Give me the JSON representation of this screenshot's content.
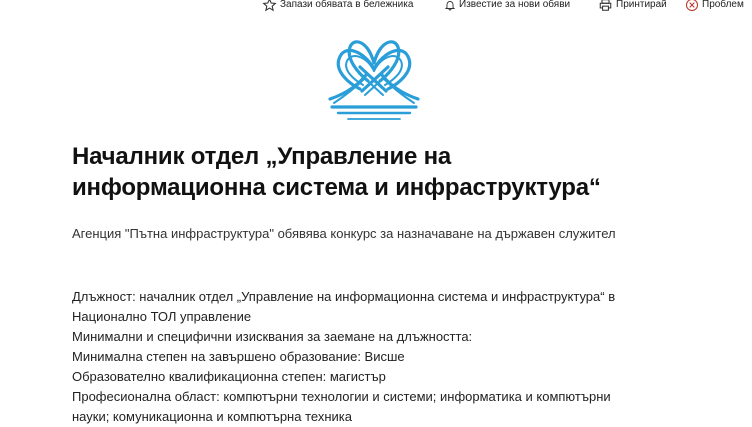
{
  "toolbar": {
    "save": "Запази обявата в бележника",
    "notify": "Известие за нови обяви",
    "print": "Принтирай",
    "report": "Проблем"
  },
  "icons": {
    "save": "star-icon",
    "notify": "bell-icon",
    "print": "printer-icon",
    "report": "close-circle-icon"
  },
  "colors": {
    "logo": "#2a9ed8",
    "report_icon": "#c0392b"
  },
  "article": {
    "title_line1": "Началник отдел „Управление на",
    "title_line2": "информационна система и инфраструктура“",
    "lead": "Агенция \"Пътна инфраструктура\" обявява конкурс за назначаване на държавен служител",
    "details": [
      "Длъжност: началник отдел „Управление на информационна система и инфраструктура“ в",
      "Национално ТОЛ управление",
      "Минимални и специфични изисквания за заемане на длъжността:",
      "Минимална степен на завършено образование: Висше",
      "Образователно квалификационна степен: магистър",
      "Професионална област: компютърни технологии и системи; информатика и компютърни",
      "науки; комуникационна и компютърна техника"
    ]
  }
}
